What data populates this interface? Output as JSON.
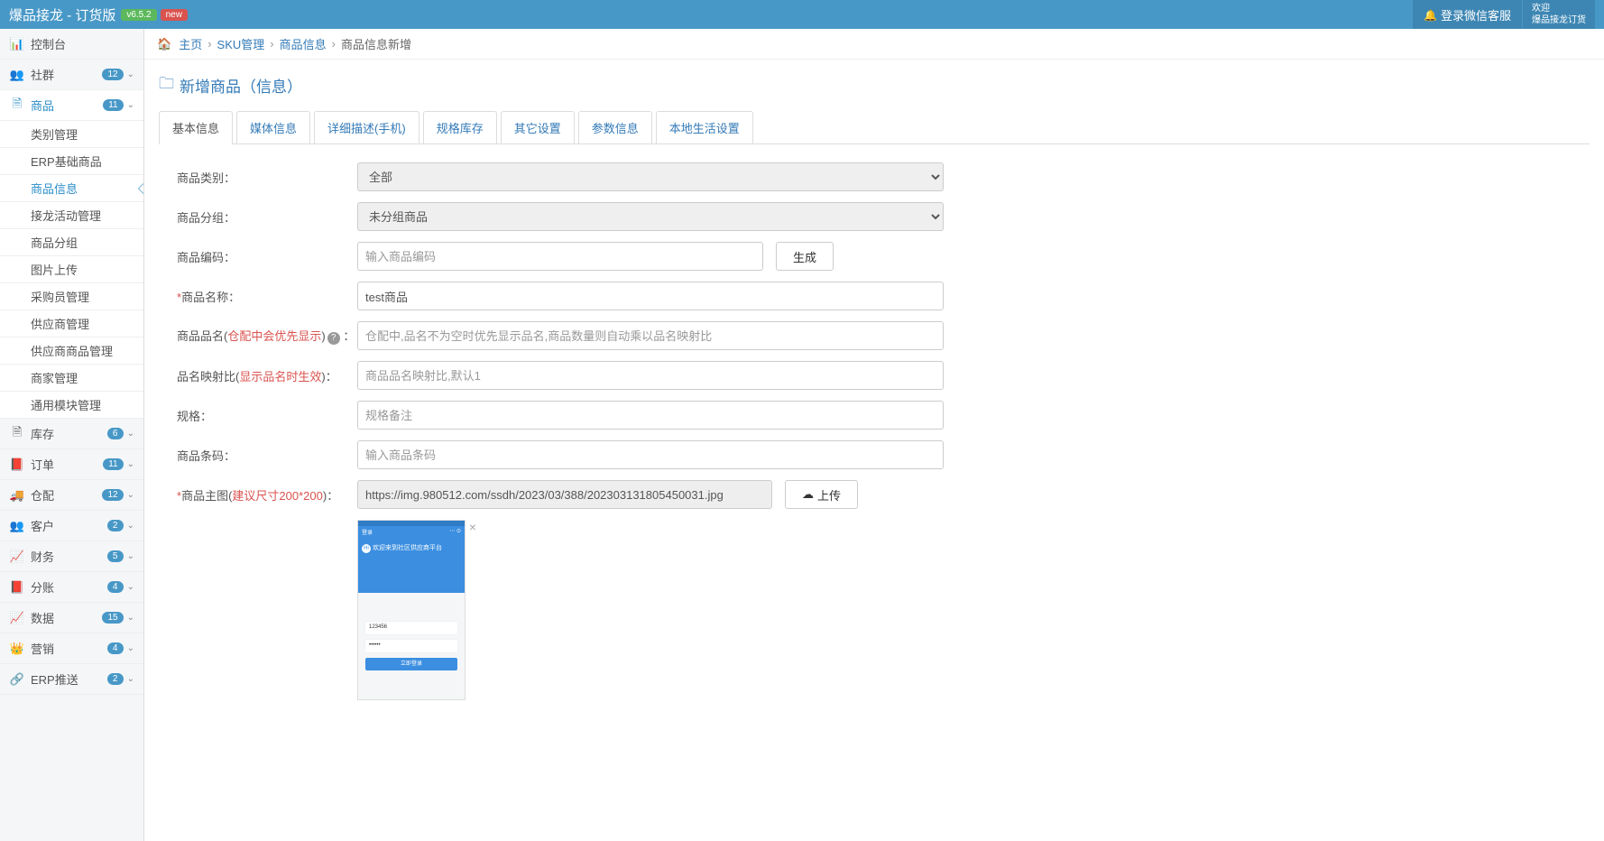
{
  "header": {
    "brand": "爆品接龙 - 订货版",
    "version": "v6.5.2",
    "newtag": "new",
    "notif_label": "登录微信客服",
    "welcome1": "欢迎",
    "welcome2": "爆品接龙订货"
  },
  "sidebar": {
    "items": [
      {
        "icon": "📊",
        "label": "控制台",
        "badge": "",
        "caret": false,
        "sub": []
      },
      {
        "icon": "👥",
        "label": "社群",
        "badge": "12",
        "caret": true,
        "sub": []
      },
      {
        "icon": "🗎",
        "label": "商品",
        "badge": "11",
        "caret": true,
        "active": true,
        "sub": [
          {
            "label": "类别管理"
          },
          {
            "label": "ERP基础商品"
          },
          {
            "label": "商品信息",
            "active": true
          },
          {
            "label": "接龙活动管理"
          },
          {
            "label": "商品分组"
          },
          {
            "label": "图片上传"
          },
          {
            "label": "采购员管理"
          },
          {
            "label": "供应商管理"
          },
          {
            "label": "供应商商品管理"
          },
          {
            "label": "商家管理"
          },
          {
            "label": "通用模块管理"
          }
        ]
      },
      {
        "icon": "🗎",
        "label": "库存",
        "badge": "6",
        "caret": true,
        "sub": []
      },
      {
        "icon": "📕",
        "label": "订单",
        "badge": "11",
        "caret": true,
        "sub": []
      },
      {
        "icon": "🚚",
        "label": "仓配",
        "badge": "12",
        "caret": true,
        "sub": []
      },
      {
        "icon": "👥",
        "label": "客户",
        "badge": "2",
        "caret": true,
        "sub": []
      },
      {
        "icon": "📈",
        "label": "财务",
        "badge": "5",
        "caret": true,
        "sub": []
      },
      {
        "icon": "📕",
        "label": "分账",
        "badge": "4",
        "caret": true,
        "sub": []
      },
      {
        "icon": "📈",
        "label": "数据",
        "badge": "15",
        "caret": true,
        "sub": []
      },
      {
        "icon": "👑",
        "label": "营销",
        "badge": "4",
        "caret": true,
        "sub": []
      },
      {
        "icon": "🔗",
        "label": "ERP推送",
        "badge": "2",
        "caret": true,
        "sub": []
      }
    ]
  },
  "breadcrumb": {
    "home": "主页",
    "l1": "SKU管理",
    "l2": "商品信息",
    "current": "商品信息新增"
  },
  "page": {
    "title": "新增商品（信息）"
  },
  "tabs": [
    {
      "label": "基本信息",
      "active": true
    },
    {
      "label": "媒体信息"
    },
    {
      "label": "详细描述(手机)"
    },
    {
      "label": "规格库存"
    },
    {
      "label": "其它设置"
    },
    {
      "label": "参数信息"
    },
    {
      "label": "本地生活设置"
    }
  ],
  "form": {
    "category": {
      "label": "商品类别：",
      "value": "全部"
    },
    "group": {
      "label": "商品分组：",
      "value": "未分组商品"
    },
    "code": {
      "label": "商品编码：",
      "placeholder": "输入商品编码",
      "btn": "生成"
    },
    "name": {
      "label": "商品名称：",
      "value": "test商品"
    },
    "alias": {
      "label_pre": "商品品名(",
      "label_red": "仓配中会优先显示",
      "label_suf": ")",
      "placeholder": "仓配中,品名不为空时优先显示品名,商品数量则自动乘以品名映射比"
    },
    "ratio": {
      "label_pre": "品名映射比(",
      "label_red": "显示品名时生效",
      "label_suf": ")：",
      "placeholder": "商品品名映射比,默认1"
    },
    "spec": {
      "label": "规格：",
      "placeholder": "规格备注"
    },
    "barcode": {
      "label": "商品条码：",
      "placeholder": "输入商品条码"
    },
    "image": {
      "label": "商品主图(",
      "label_red": "建议尺寸200*200",
      "label_suf": ")：",
      "value": "https://img.980512.com/ssdh/2023/03/388/202303131805450031.jpg",
      "btn": "上传"
    }
  },
  "preview": {
    "title_left": "登录",
    "hi": "Hi",
    "welcome": "欢迎来到社区供应商平台",
    "field1": "123456",
    "field2": "••••••",
    "btn": "立即登录"
  }
}
